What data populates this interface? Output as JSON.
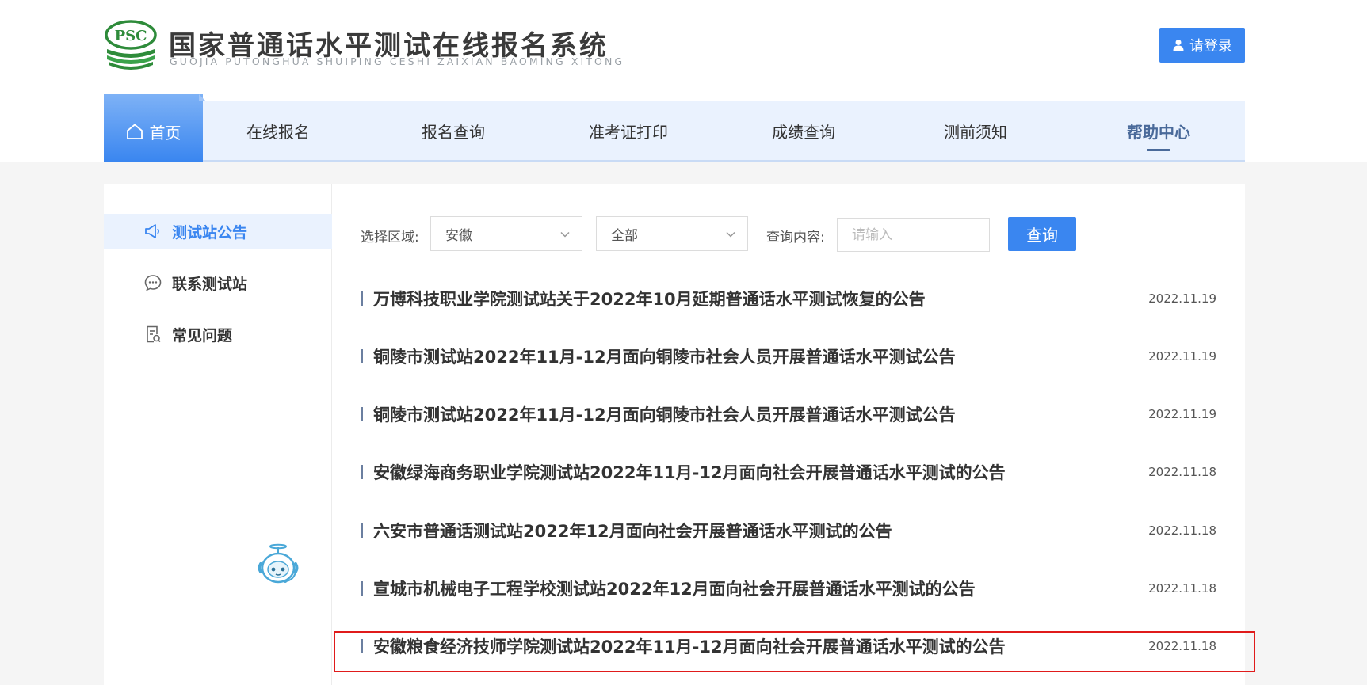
{
  "header": {
    "logo_text": "PSC",
    "title_cn": "国家普通话水平测试在线报名系统",
    "title_en": "GUOJIA PUTONGHUA SHUIPING CESHI ZAIXIAN BAOMING XITONG",
    "login_label": "请登录"
  },
  "nav": {
    "items": [
      {
        "label": "首页",
        "icon": "home-icon",
        "active": false
      },
      {
        "label": "在线报名"
      },
      {
        "label": "报名查询"
      },
      {
        "label": "准考证打印"
      },
      {
        "label": "成绩查询"
      },
      {
        "label": "测前须知"
      },
      {
        "label": "帮助中心",
        "active": true
      }
    ]
  },
  "sidebar": {
    "items": [
      {
        "label": "测试站公告",
        "icon": "megaphone-icon",
        "active": true
      },
      {
        "label": "联系测试站",
        "icon": "chat-bubble-icon"
      },
      {
        "label": "常见问题",
        "icon": "document-icon"
      }
    ]
  },
  "filters": {
    "region_label": "选择区域:",
    "region_value": "安徽",
    "city_value": "全部",
    "query_label": "查询内容:",
    "query_placeholder": "请输入",
    "search_label": "查询"
  },
  "notices": [
    {
      "title": "万博科技职业学院测试站关于2022年10月延期普通话水平测试恢复的公告",
      "date": "2022.11.19"
    },
    {
      "title": "铜陵市测试站2022年11月-12月面向铜陵市社会人员开展普通话水平测试公告",
      "date": "2022.11.19"
    },
    {
      "title": "铜陵市测试站2022年11月-12月面向铜陵市社会人员开展普通话水平测试公告",
      "date": "2022.11.19"
    },
    {
      "title": "安徽绿海商务职业学院测试站2022年11月-12月面向社会开展普通话水平测试的公告",
      "date": "2022.11.18"
    },
    {
      "title": "六安市普通话测试站2022年12月面向社会开展普通话水平测试的公告",
      "date": "2022.11.18"
    },
    {
      "title": "宣城市机械电子工程学校测试站2022年12月面向社会开展普通话水平测试的公告",
      "date": "2022.11.18"
    },
    {
      "title": "安徽粮食经济技师学院测试站2022年11月-12月面向社会开展普通话水平测试的公告",
      "date": "2022.11.18",
      "highlighted": true
    }
  ],
  "colors": {
    "primary": "#3a86f0",
    "nav_bg": "#eaf2fe",
    "highlight": "#e01b1b",
    "logo_green": "#2e8b3a"
  }
}
